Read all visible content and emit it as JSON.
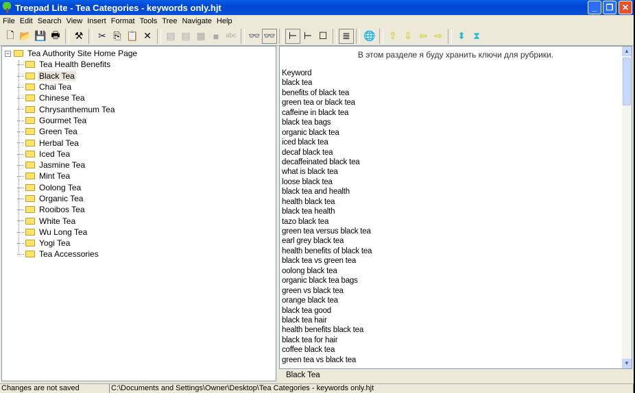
{
  "title": "Treepad Lite - Tea Categories - keywords only.hjt",
  "menu": [
    "File",
    "Edit",
    "Search",
    "View",
    "Insert",
    "Format",
    "Tools",
    "Tree",
    "Navigate",
    "Help"
  ],
  "tree": {
    "root": "Tea Authority Site Home Page",
    "selected": "Black Tea",
    "children": [
      "Tea Health Benefits",
      "Black Tea",
      "Chai Tea",
      "Chinese Tea",
      "Chrysanthemum Tea",
      "Gourmet Tea",
      "Green Tea",
      "Herbal Tea",
      "Iced Tea",
      "Jasmine Tea",
      "Mint Tea",
      "Oolong Tea",
      "Organic Tea",
      "Rooibos Tea",
      "White Tea",
      "Wu Long Tea",
      "Yogi Tea",
      "Tea Accessories"
    ]
  },
  "editor": {
    "heading": "В этом разделе я буду хранить ключи для рубрики.",
    "lines": [
      "Keyword",
      "black tea",
      "benefits of black tea",
      "green tea or black tea",
      "caffeine in black tea",
      "black tea bags",
      "organic black tea",
      "iced black tea",
      "decaf black tea",
      "decaffeinated black tea",
      "what is black tea",
      "loose black tea",
      "black tea and health",
      "health black tea",
      "black tea health",
      "tazo black tea",
      "green tea versus black tea",
      "earl grey black tea",
      "health benefits of black tea",
      "black tea vs green tea",
      "oolong black tea",
      "organic black tea bags",
      "green vs black tea",
      "orange black tea",
      "black tea good",
      "black tea hair",
      "health benefits black tea",
      "black tea for hair",
      "coffee black tea",
      "green tea vs black tea"
    ]
  },
  "caption": "Black Tea",
  "status": {
    "saved": "Changes are not saved",
    "path": "C:\\Documents and Settings\\Owner\\Desktop\\Tea Categories - keywords only.hjt"
  }
}
